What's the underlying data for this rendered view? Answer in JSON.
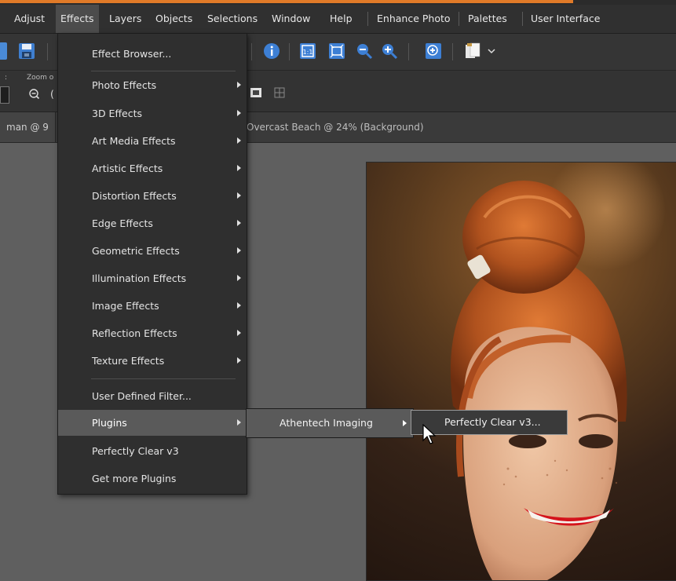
{
  "menubar": {
    "items": [
      "Adjust",
      "Effects",
      "Layers",
      "Objects",
      "Selections",
      "Window",
      "Help",
      "Enhance Photo",
      "Palettes",
      "User Interface"
    ],
    "active": "Effects"
  },
  "options_bar": {
    "zoom_label": "Zoom o"
  },
  "tabs": [
    {
      "label": "man @  9"
    },
    {
      "label": "Overcast Beach @  24% (Background)"
    }
  ],
  "effects_menu": {
    "items": [
      {
        "label": "Effect Browser...",
        "submenu": false
      },
      {
        "label": "Photo Effects",
        "submenu": true
      },
      {
        "label": "3D Effects",
        "submenu": true
      },
      {
        "label": "Art Media Effects",
        "submenu": true
      },
      {
        "label": "Artistic Effects",
        "submenu": true
      },
      {
        "label": "Distortion Effects",
        "submenu": true
      },
      {
        "label": "Edge Effects",
        "submenu": true
      },
      {
        "label": "Geometric Effects",
        "submenu": true
      },
      {
        "label": "Illumination Effects",
        "submenu": true
      },
      {
        "label": "Image Effects",
        "submenu": true
      },
      {
        "label": "Reflection Effects",
        "submenu": true
      },
      {
        "label": "Texture Effects",
        "submenu": true
      },
      {
        "label": "User Defined Filter...",
        "submenu": false
      },
      {
        "label": "Plugins",
        "submenu": true,
        "highlighted": true
      },
      {
        "label": "Perfectly Clear v3",
        "submenu": false
      },
      {
        "label": "Get more Plugins",
        "submenu": false
      }
    ]
  },
  "plugins_submenu": {
    "items": [
      {
        "label": "Athentech Imaging",
        "submenu": true,
        "highlighted": true
      }
    ]
  },
  "athentech_submenu": {
    "items": [
      {
        "label": "Perfectly Clear v3...",
        "highlighted": true
      }
    ]
  },
  "colors": {
    "accent": "#e07a28",
    "menu_bg": "#2f2f2f",
    "highlight": "#5a5a5a",
    "workspace": "#5f5f5f"
  }
}
